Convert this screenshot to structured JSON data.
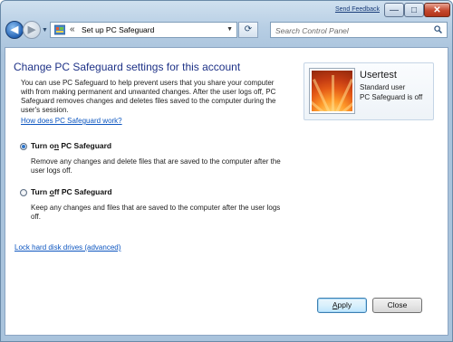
{
  "titlebar": {
    "feedback_label": "Send Feedback",
    "minimize_glyph": "—",
    "maximize_glyph": "□",
    "close_glyph": "✕"
  },
  "nav": {
    "back_glyph": "◀",
    "forward_glyph": "▶",
    "address_separator": "«",
    "address_path": "Set up PC Safeguard",
    "refresh_glyph": "⟳",
    "search_placeholder": "Search Control Panel"
  },
  "main": {
    "title": "Change PC Safeguard settings for this account",
    "description": "You can use PC Safeguard to help prevent users that you share your computer with from making permanent and unwanted changes. After the user logs off, PC Safeguard removes changes and deletes files saved to the computer during the user's session.",
    "how_link_pre": "Ho",
    "how_link_u": "w",
    "how_link_post": " does PC Safeguard work?",
    "lock_link_u": "L",
    "lock_link_post": "ock hard disk drives (advanced)"
  },
  "user_card": {
    "name": "Usertest",
    "type": "Standard user",
    "status": "PC Safeguard is off"
  },
  "options": [
    {
      "label_pre": "Turn o",
      "label_u": "n",
      "label_post": " PC Safeguard",
      "description": "Remove any changes and delete files that are saved to the computer after the user logs off.",
      "selected": true
    },
    {
      "label_pre": "Turn ",
      "label_u": "o",
      "label_post": "ff PC Safeguard",
      "description": "Keep any changes and  files that are saved to the computer after the user logs off.",
      "selected": false
    }
  ],
  "buttons": {
    "apply_u": "A",
    "apply_post": "pply",
    "close_label": "Close"
  },
  "colors": {
    "title": "#1e3287",
    "link": "#0d56c0",
    "frame": "#b7cee4"
  }
}
